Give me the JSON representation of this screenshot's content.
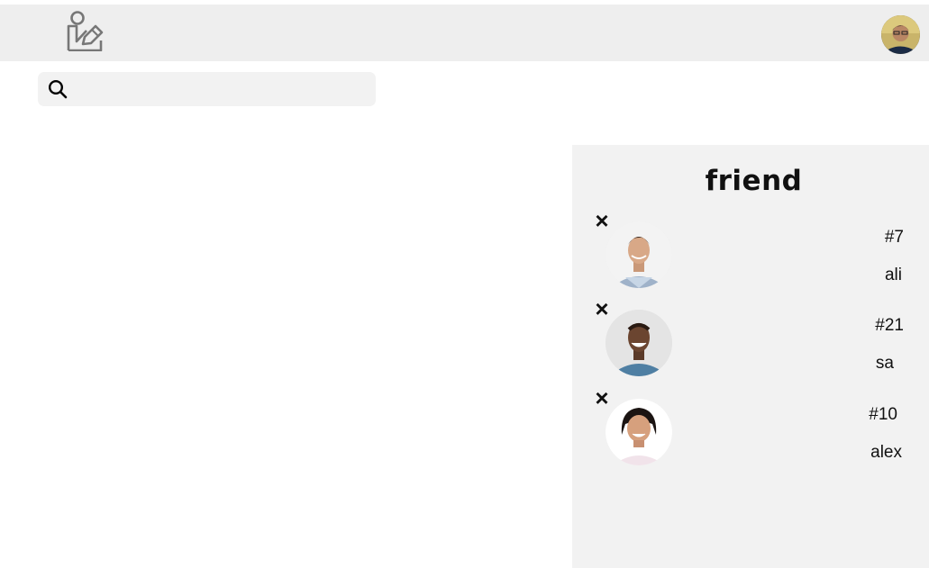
{
  "header": {
    "logo_icon": "person-edit-icon",
    "avatar_icon": "user-avatar"
  },
  "search": {
    "icon": "search-icon",
    "placeholder": "",
    "value": ""
  },
  "friends_panel": {
    "title": "friend",
    "remove_icon": "close-icon",
    "items": [
      {
        "id": "#7",
        "name": "ali"
      },
      {
        "id": "#21",
        "name": "sa"
      },
      {
        "id": "#10",
        "name": "alex"
      }
    ]
  },
  "colors": {
    "header_bg": "#eeeeee",
    "panel_bg": "#f2f2f2",
    "search_bg": "#f2f2f2"
  }
}
